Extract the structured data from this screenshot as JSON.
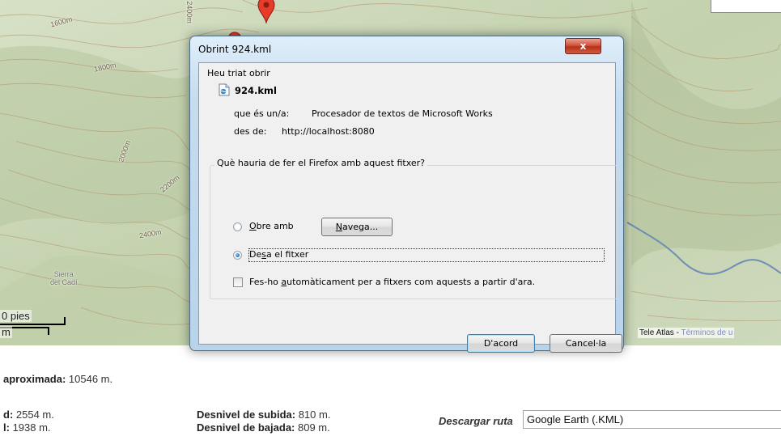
{
  "map": {
    "contour_labels": [
      "1600m",
      "1800m",
      "2000m",
      "2200m",
      "2400m",
      "2400m"
    ],
    "place_label_line1": "Sierra",
    "place_label_line2": "del Cadí",
    "scale_top": "0 pies",
    "scale_bottom": "m",
    "attribution_text": "Tele Atlas - ",
    "attribution_link": "Términos de u",
    "colors": {
      "terrain": "#c9d6b6",
      "river": "#6d8fb3",
      "marker": "#e63c2a"
    }
  },
  "dialog": {
    "title": "Obrint 924.kml",
    "close_glyph": "x",
    "intro": "Heu triat obrir",
    "file_name": "924.kml",
    "type_label": "que és un/a:",
    "type_value": "Procesador de textos de Microsoft Works",
    "from_label": "des de:",
    "from_value": "http://localhost:8080",
    "question": "Què hauria de fer el Firefox amb aquest fitxer?",
    "open_with_pre": "",
    "open_with_ul": "O",
    "open_with_post": "bre amb",
    "browse_pre": "",
    "browse_ul": "N",
    "browse_post": "avega...",
    "save_pre": "De",
    "save_ul": "s",
    "save_post": "a el fitxer",
    "auto_pre": "Fes-ho ",
    "auto_ul": "a",
    "auto_post": "utomàticament per a fitxers com aquests a partir d'ara.",
    "ok_label": "D'acord",
    "cancel_label": "Cancel·la",
    "selected_option": "save"
  },
  "stats": {
    "distance_label": "aproximada:",
    "distance_value": " 10546 m.",
    "max_alt_label": "d:",
    "max_alt_value": " 2554 m.",
    "min_alt_label": "l:",
    "min_alt_value": " 1938 m.",
    "ascent_label": "Desnivel de subida:",
    "ascent_value": " 810 m.",
    "descent_label": "Desnivel de bajada:",
    "descent_value": " 809 m.",
    "download_label": "Descargar ruta",
    "download_value": "Google Earth (.KML)"
  }
}
